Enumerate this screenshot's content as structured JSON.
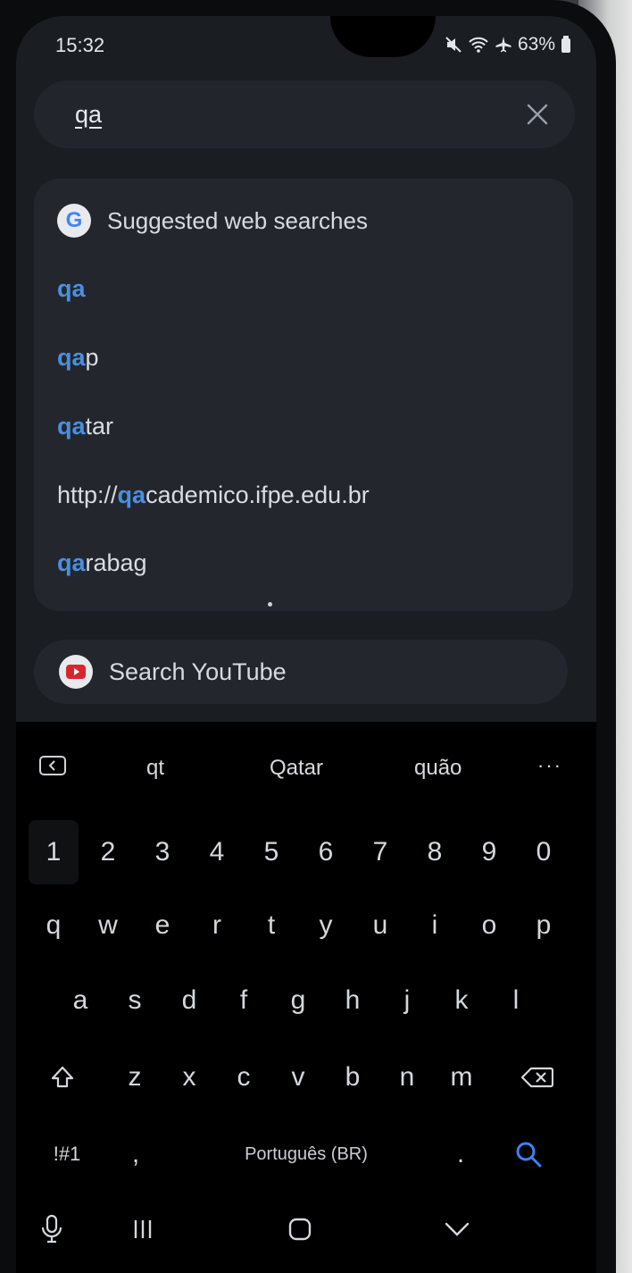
{
  "status_bar": {
    "time": "15:32",
    "battery": "63%",
    "icons": [
      "mute-icon",
      "wifi-icon",
      "airplane-icon",
      "battery-icon"
    ]
  },
  "search": {
    "query": "qa",
    "clear_icon": "close-icon"
  },
  "suggestions": {
    "header": "Suggested web searches",
    "items": [
      {
        "match": "qa",
        "rest": ""
      },
      {
        "match": "qa",
        "rest": "p"
      },
      {
        "match": "qa",
        "rest": "tar"
      },
      {
        "prefix": "http://",
        "match": "qa",
        "rest": "cademico.ifpe.edu.br"
      },
      {
        "match": "qa",
        "rest": "rabag"
      }
    ]
  },
  "youtube": {
    "label": "Search YouTube"
  },
  "keyboard": {
    "predictions": [
      "qt",
      "Qatar",
      "quão"
    ],
    "more": "···",
    "number_row": [
      "1",
      "2",
      "3",
      "4",
      "5",
      "6",
      "7",
      "8",
      "9",
      "0"
    ],
    "row1": [
      "q",
      "w",
      "e",
      "r",
      "t",
      "y",
      "u",
      "i",
      "o",
      "p"
    ],
    "row2": [
      "a",
      "s",
      "d",
      "f",
      "g",
      "h",
      "j",
      "k",
      "l"
    ],
    "row3": [
      "z",
      "x",
      "c",
      "v",
      "b",
      "n",
      "m"
    ],
    "symbols_key": "!#1",
    "comma": ",",
    "language": "Português (BR)",
    "period": ".",
    "accent_color": "#3b82f6"
  },
  "nav": {
    "icons": [
      "microphone-icon",
      "recent-apps-icon",
      "home-icon",
      "hide-keyboard-icon"
    ]
  }
}
